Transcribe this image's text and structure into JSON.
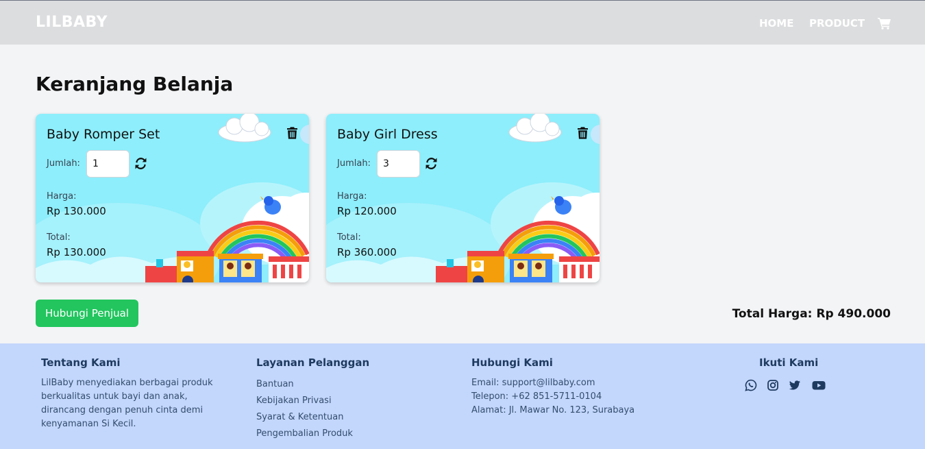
{
  "navbar": {
    "brand": "LILBABY",
    "links": [
      {
        "label": "HOME"
      },
      {
        "label": "PRODUCT"
      }
    ],
    "cart_icon": "shopping-cart-icon"
  },
  "page": {
    "title": "Keranjang Belanja"
  },
  "cart_items": [
    {
      "name": "Baby Romper Set",
      "qty_label": "Jumlah:",
      "qty": "1",
      "price_label": "Harga:",
      "price": "Rp 130.000",
      "total_label": "Total:",
      "total": "Rp 130.000"
    },
    {
      "name": "Baby Girl Dress",
      "qty_label": "Jumlah:",
      "qty": "3",
      "price_label": "Harga:",
      "price": "Rp 120.000",
      "total_label": "Total:",
      "total": "Rp 360.000"
    }
  ],
  "actions": {
    "contact_seller": "Hubungi Penjual",
    "grand_total": "Total Harga: Rp 490.000"
  },
  "footer": {
    "about": {
      "title": "Tentang Kami",
      "text": "LilBaby menyediakan berbagai produk berkualitas untuk bayi dan anak, dirancang dengan penuh cinta demi kenyamanan Si Kecil."
    },
    "service": {
      "title": "Layanan Pelanggan",
      "links": [
        "Bantuan",
        "Kebijakan Privasi",
        "Syarat & Ketentuan",
        "Pengembalian Produk"
      ]
    },
    "contact": {
      "title": "Hubungi Kami",
      "email": "Email: support@lilbaby.com",
      "phone": "Telepon: +62 851-5711-0104",
      "address": "Alamat: Jl. Mawar No. 123, Surabaya"
    },
    "social": {
      "title": "Ikuti Kami",
      "icons": [
        "whatsapp-icon",
        "instagram-icon",
        "twitter-icon",
        "youtube-icon"
      ]
    }
  },
  "colors": {
    "navbar_bg": "#dcdddf",
    "page_bg": "#f3f4f6",
    "card_sky": "#8eeefb",
    "button_green": "#22c55e",
    "footer_bg": "#c3d6fc",
    "footer_text": "#1e3a5f"
  }
}
